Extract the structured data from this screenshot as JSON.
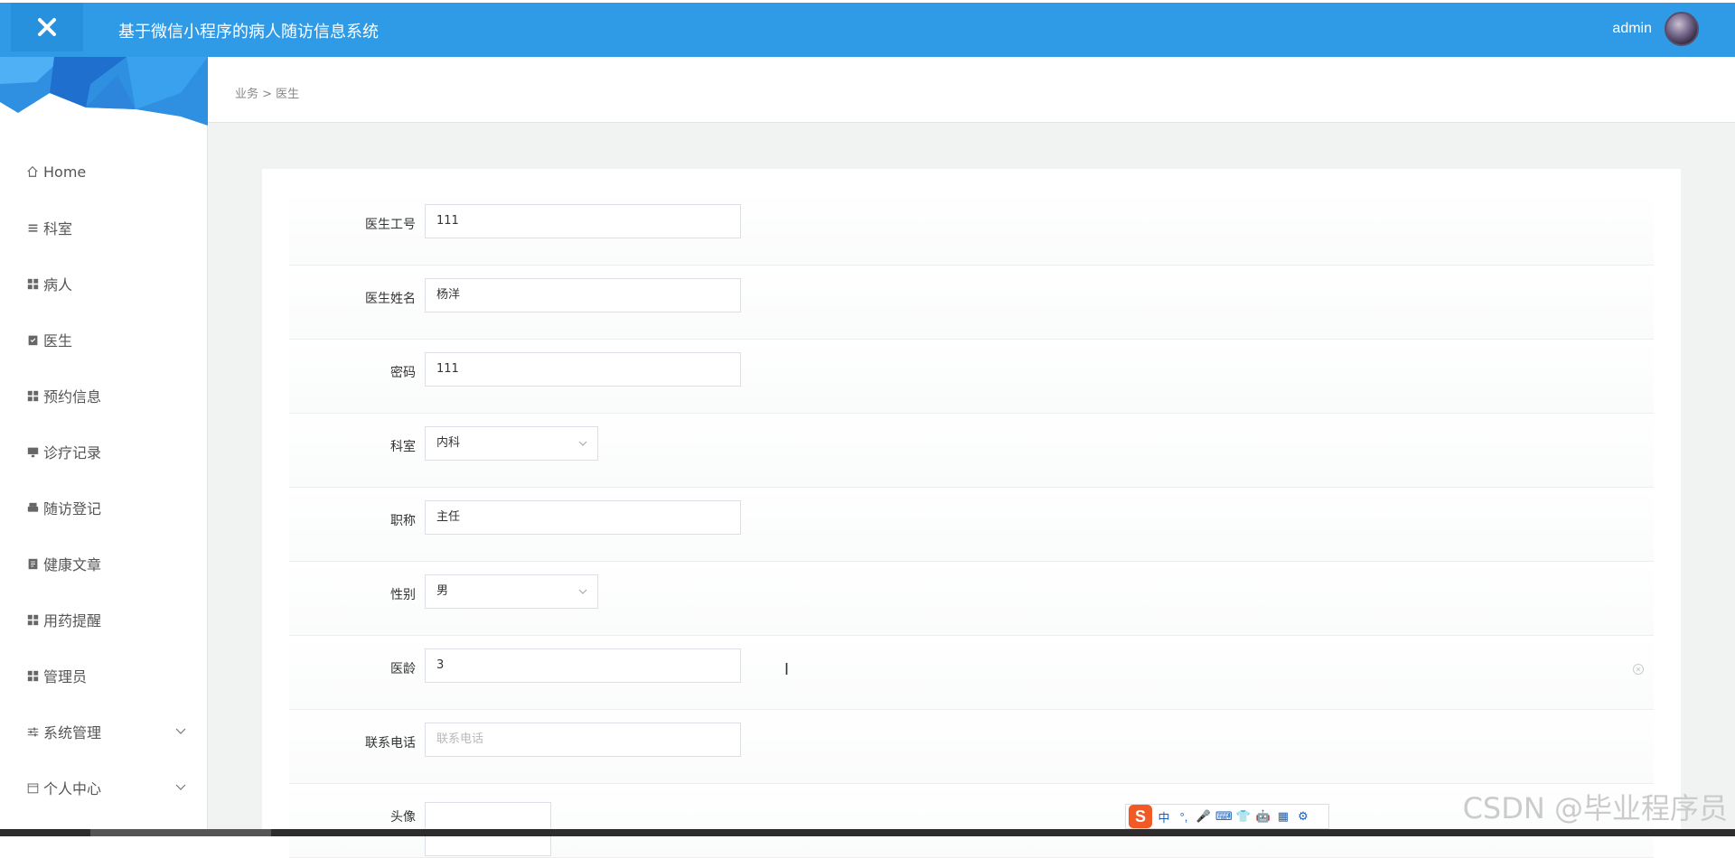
{
  "header": {
    "title": "基于微信小程序的病人随访信息系统",
    "username": "admin"
  },
  "breadcrumb": "业务 > 医生",
  "sidebar": {
    "items": [
      {
        "label": "Home",
        "icon": "home-icon"
      },
      {
        "label": "科室",
        "icon": "list-icon"
      },
      {
        "label": "病人",
        "icon": "grid-icon"
      },
      {
        "label": "医生",
        "icon": "clipboard-icon"
      },
      {
        "label": "预约信息",
        "icon": "grid-icon"
      },
      {
        "label": "诊疗记录",
        "icon": "monitor-icon"
      },
      {
        "label": "随访登记",
        "icon": "printer-icon"
      },
      {
        "label": "健康文章",
        "icon": "document-icon"
      },
      {
        "label": "用药提醒",
        "icon": "grid-icon"
      },
      {
        "label": "管理员",
        "icon": "grid-icon"
      },
      {
        "label": "系统管理",
        "icon": "sliders-icon"
      },
      {
        "label": "个人中心",
        "icon": "calendar-icon"
      }
    ]
  },
  "form": {
    "fields": [
      {
        "label": "医生工号",
        "value": "111",
        "type": "text"
      },
      {
        "label": "医生姓名",
        "value": "杨洋",
        "type": "text"
      },
      {
        "label": "密码",
        "value": "111",
        "type": "text"
      },
      {
        "label": "科室",
        "value": "内科",
        "type": "select"
      },
      {
        "label": "职称",
        "value": "主任",
        "type": "text"
      },
      {
        "label": "性别",
        "value": "男",
        "type": "select"
      },
      {
        "label": "医龄",
        "value": "3",
        "type": "text"
      },
      {
        "label": "联系电话",
        "placeholder": "联系电话",
        "type": "text"
      },
      {
        "label": "头像",
        "type": "upload"
      }
    ]
  },
  "ime": {
    "logo": "S",
    "items": [
      "中",
      "°,",
      "🎤",
      "⌨",
      "👕",
      "🤖",
      "▦",
      "⚙"
    ]
  },
  "watermark": "CSDN @毕业程序员",
  "colors": {
    "header_bg": "#2f9be6",
    "content_bg": "#f1f3f3",
    "ime_logo": "#f15a24"
  }
}
